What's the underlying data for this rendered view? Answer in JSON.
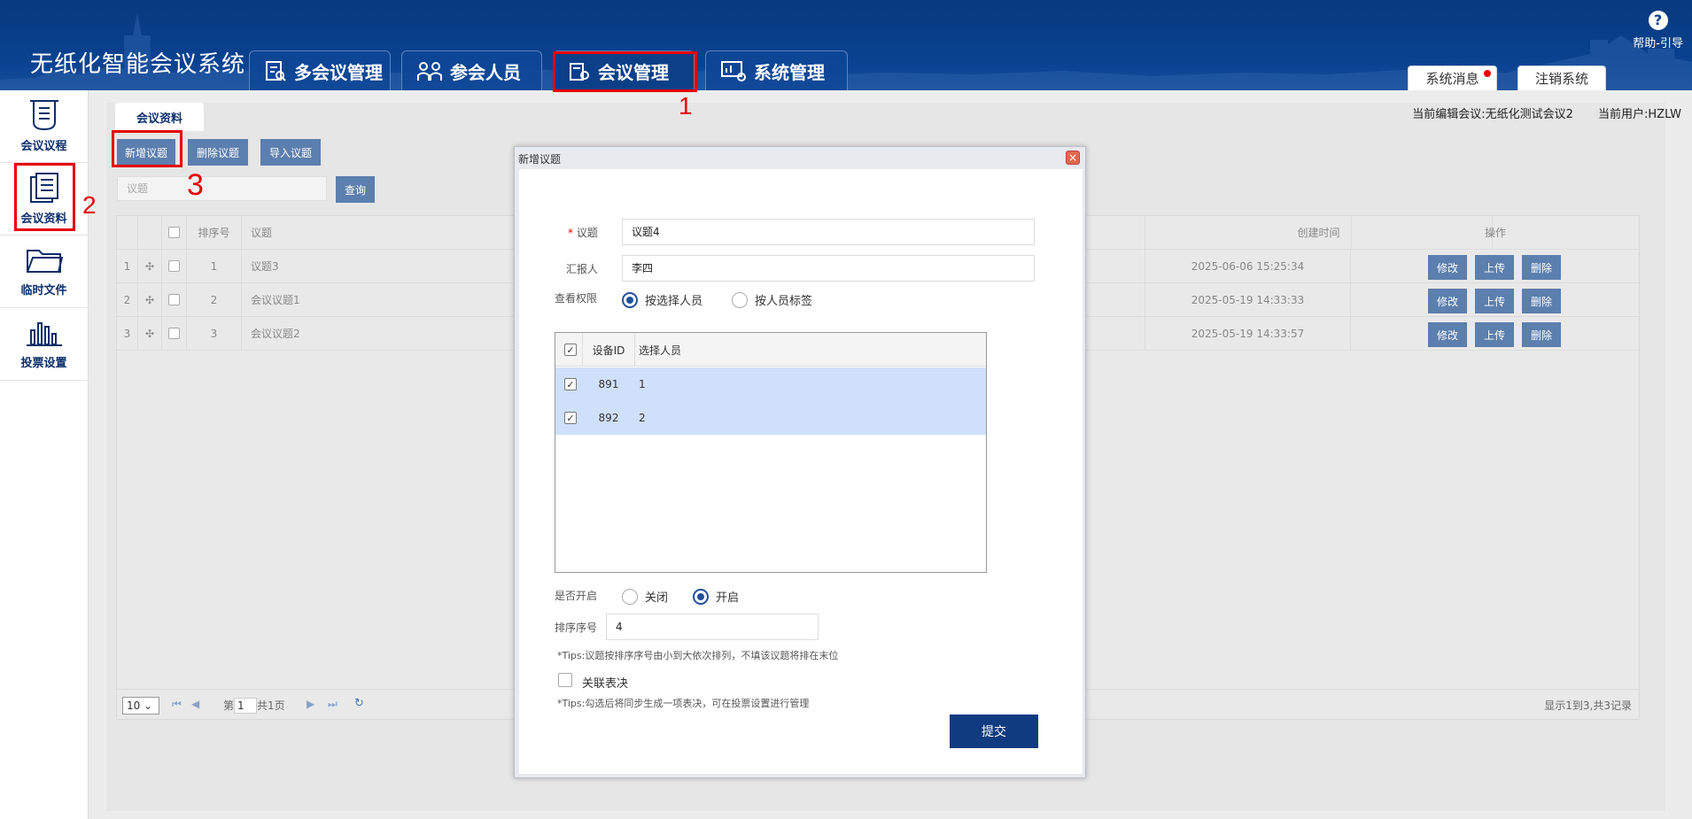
{
  "header": {
    "app_title": "无纸化智能会议系统",
    "nav_tabs": [
      {
        "label": "多会议管理"
      },
      {
        "label": "参会人员"
      },
      {
        "label": "会议管理"
      },
      {
        "label": "系统管理"
      }
    ],
    "help_label": "帮助-引导",
    "system_msg_label": "系统消息",
    "logout_label": "注销系统"
  },
  "sidebar": {
    "items": [
      {
        "label": "会议议程",
        "icon": "agenda-icon"
      },
      {
        "label": "会议资料",
        "icon": "documents-icon"
      },
      {
        "label": "临时文件",
        "icon": "folder-icon"
      },
      {
        "label": "投票设置",
        "icon": "vote-chart-icon"
      }
    ]
  },
  "content": {
    "subtab_label": "会议资料",
    "current_meeting": "当前编辑会议:无纸化测试会议2",
    "current_user": "当前用户:HZLW",
    "toolbar": {
      "add_label": "新增议题",
      "delete_label": "删除议题",
      "import_label": "导入议题"
    },
    "search_placeholder": "议题",
    "query_label": "查询",
    "grid": {
      "headers": {
        "order": "排序号",
        "topic": "议题",
        "created": "创建时间",
        "actions": "操作"
      },
      "rows": [
        {
          "idx": "1",
          "order": "1",
          "topic": "议题3",
          "created": "2025-06-06 15:25:34"
        },
        {
          "idx": "2",
          "order": "2",
          "topic": "会议议题1",
          "created": "2025-05-19 14:33:33"
        },
        {
          "idx": "3",
          "order": "3",
          "topic": "会议议题2",
          "created": "2025-05-19 14:33:57"
        }
      ],
      "row_actions": {
        "edit": "修改",
        "upload": "上传",
        "delete": "删除"
      },
      "pager": {
        "page_size": "10",
        "page_prefix": "第",
        "page_value": "1",
        "page_suffix": "共1页",
        "summary": "显示1到3,共3记录"
      }
    }
  },
  "annotations": {
    "n1": "1",
    "n2": "2",
    "n3": "3"
  },
  "modal": {
    "title": "新增议题",
    "topic_label": "议题",
    "topic_value": "议题4",
    "reporter_label": "汇报人",
    "reporter_value": "李四",
    "permission_label": "查看权限",
    "perm_by_person": "按选择人员",
    "perm_by_tag": "按人员标签",
    "people_headers": {
      "device_id": "设备ID",
      "person": "选择人员"
    },
    "people_rows": [
      {
        "device_id": "891",
        "person": "1"
      },
      {
        "device_id": "892",
        "person": "2"
      }
    ],
    "enable_label": "是否开启",
    "enable_off": "关闭",
    "enable_on": "开启",
    "order_label": "排序序号",
    "order_value": "4",
    "order_tip": "*Tips:议题按排序序号由小到大依次排列，不填该议题将排在末位",
    "link_vote_label": "关联表决",
    "link_vote_tip": "*Tips:勾选后将同步生成一项表决，可在投票设置进行管理",
    "submit_label": "提交"
  },
  "colors": {
    "header_blue": "#0a4291",
    "button_blue": "#5b7fae",
    "submit_blue": "#113b80",
    "annotation_red": "#e60000"
  }
}
